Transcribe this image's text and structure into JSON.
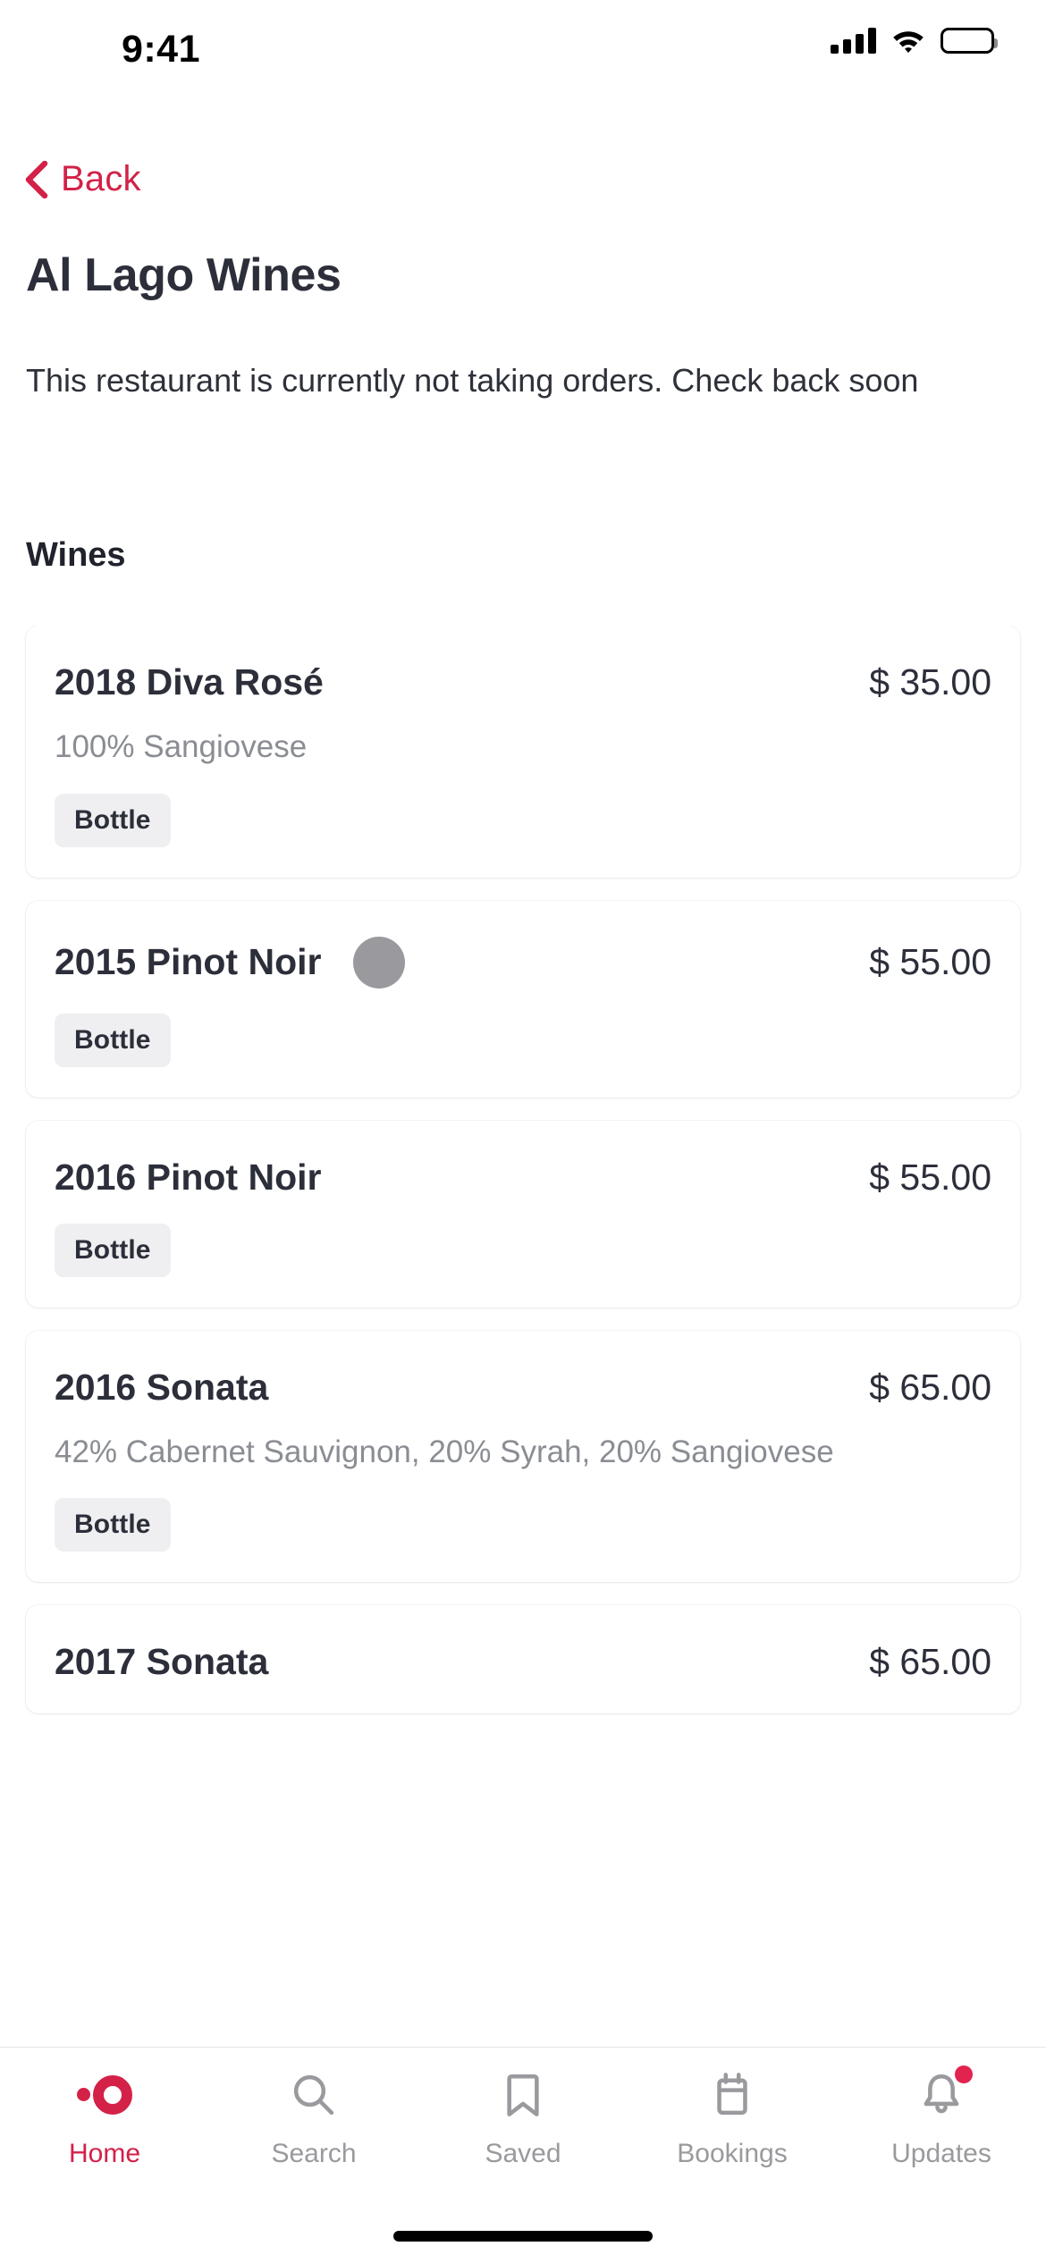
{
  "status_bar": {
    "time": "9:41",
    "icons": [
      "cellular-signal-icon",
      "wifi-icon",
      "battery-icon"
    ]
  },
  "nav": {
    "back_label": "Back",
    "back_icon": "chevron-left-icon",
    "accent_color": "#D32148"
  },
  "header": {
    "title": "Al Lago Wines",
    "notice": "This restaurant is currently not taking orders. Check back soon"
  },
  "menu": {
    "section_title": "Wines",
    "items": [
      {
        "name": "2018 Diva Rosé",
        "price": "$ 35.00",
        "description": "100% Sangiovese",
        "tags": [
          "Bottle"
        ],
        "has_thumb": false
      },
      {
        "name": "2015 Pinot Noir",
        "price": "$ 55.00",
        "description": "",
        "tags": [
          "Bottle"
        ],
        "has_thumb": true,
        "thumb_color": "#9A9A9E"
      },
      {
        "name": "2016 Pinot Noir",
        "price": "$ 55.00",
        "description": "",
        "tags": [
          "Bottle"
        ],
        "has_thumb": false
      },
      {
        "name": "2016 Sonata",
        "price": "$ 65.00",
        "description": "42% Cabernet Sauvignon, 20% Syrah, 20% Sangiovese",
        "tags": [
          "Bottle"
        ],
        "has_thumb": false
      },
      {
        "name": "2017 Sonata",
        "price": "$ 65.00",
        "description": "",
        "tags": [],
        "has_thumb": false
      }
    ]
  },
  "tabbar": {
    "active_index": 0,
    "items": [
      {
        "label": "Home",
        "icon": "home-ring-icon",
        "badge": false
      },
      {
        "label": "Search",
        "icon": "search-icon",
        "badge": false
      },
      {
        "label": "Saved",
        "icon": "bookmark-icon",
        "badge": false
      },
      {
        "label": "Bookings",
        "icon": "calendar-icon",
        "badge": false
      },
      {
        "label": "Updates",
        "icon": "bell-icon",
        "badge": true
      }
    ]
  }
}
